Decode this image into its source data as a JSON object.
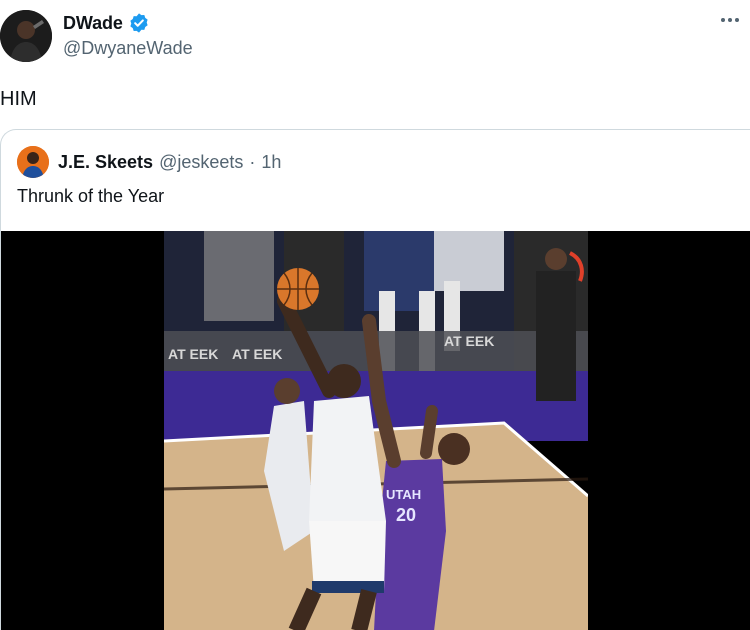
{
  "author": {
    "display_name": "DWade",
    "handle": "@DwyaneWade",
    "verified": true
  },
  "tweet": {
    "text": "HIM"
  },
  "quoted_tweet": {
    "display_name": "J.E. Skeets",
    "handle": "@jeskeets",
    "separator": "·",
    "time": "1h",
    "text": "Thrunk of the Year"
  },
  "media": {
    "type": "video-frame",
    "floor_sign_text": "AT EEK",
    "jersey_brand": "UTAH",
    "jersey_number": "20"
  },
  "colors": {
    "verified_blue": "#1d9bf0",
    "secondary_text": "#536471",
    "border": "#cfd9de",
    "court_purple": "#3d2a94",
    "jersey_purple": "#5b3aa0"
  }
}
